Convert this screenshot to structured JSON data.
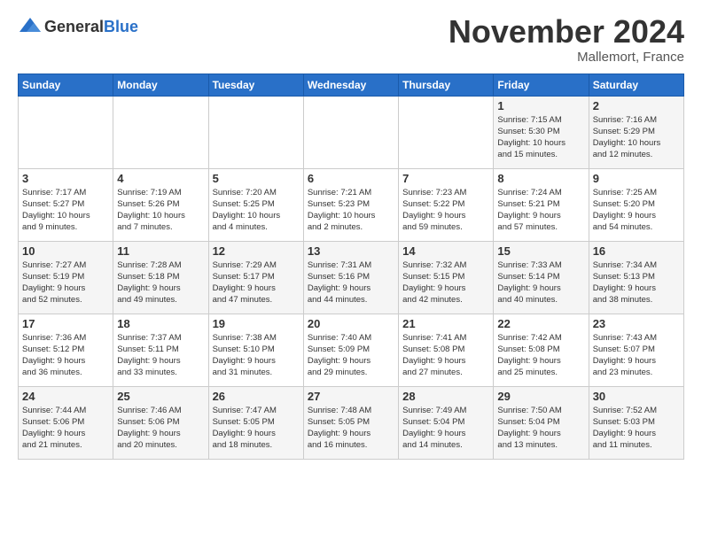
{
  "logo": {
    "text_general": "General",
    "text_blue": "Blue"
  },
  "title": "November 2024",
  "location": "Mallemort, France",
  "days_of_week": [
    "Sunday",
    "Monday",
    "Tuesday",
    "Wednesday",
    "Thursday",
    "Friday",
    "Saturday"
  ],
  "weeks": [
    [
      {
        "num": "",
        "info": ""
      },
      {
        "num": "",
        "info": ""
      },
      {
        "num": "",
        "info": ""
      },
      {
        "num": "",
        "info": ""
      },
      {
        "num": "",
        "info": ""
      },
      {
        "num": "1",
        "info": "Sunrise: 7:15 AM\nSunset: 5:30 PM\nDaylight: 10 hours\nand 15 minutes."
      },
      {
        "num": "2",
        "info": "Sunrise: 7:16 AM\nSunset: 5:29 PM\nDaylight: 10 hours\nand 12 minutes."
      }
    ],
    [
      {
        "num": "3",
        "info": "Sunrise: 7:17 AM\nSunset: 5:27 PM\nDaylight: 10 hours\nand 9 minutes."
      },
      {
        "num": "4",
        "info": "Sunrise: 7:19 AM\nSunset: 5:26 PM\nDaylight: 10 hours\nand 7 minutes."
      },
      {
        "num": "5",
        "info": "Sunrise: 7:20 AM\nSunset: 5:25 PM\nDaylight: 10 hours\nand 4 minutes."
      },
      {
        "num": "6",
        "info": "Sunrise: 7:21 AM\nSunset: 5:23 PM\nDaylight: 10 hours\nand 2 minutes."
      },
      {
        "num": "7",
        "info": "Sunrise: 7:23 AM\nSunset: 5:22 PM\nDaylight: 9 hours\nand 59 minutes."
      },
      {
        "num": "8",
        "info": "Sunrise: 7:24 AM\nSunset: 5:21 PM\nDaylight: 9 hours\nand 57 minutes."
      },
      {
        "num": "9",
        "info": "Sunrise: 7:25 AM\nSunset: 5:20 PM\nDaylight: 9 hours\nand 54 minutes."
      }
    ],
    [
      {
        "num": "10",
        "info": "Sunrise: 7:27 AM\nSunset: 5:19 PM\nDaylight: 9 hours\nand 52 minutes."
      },
      {
        "num": "11",
        "info": "Sunrise: 7:28 AM\nSunset: 5:18 PM\nDaylight: 9 hours\nand 49 minutes."
      },
      {
        "num": "12",
        "info": "Sunrise: 7:29 AM\nSunset: 5:17 PM\nDaylight: 9 hours\nand 47 minutes."
      },
      {
        "num": "13",
        "info": "Sunrise: 7:31 AM\nSunset: 5:16 PM\nDaylight: 9 hours\nand 44 minutes."
      },
      {
        "num": "14",
        "info": "Sunrise: 7:32 AM\nSunset: 5:15 PM\nDaylight: 9 hours\nand 42 minutes."
      },
      {
        "num": "15",
        "info": "Sunrise: 7:33 AM\nSunset: 5:14 PM\nDaylight: 9 hours\nand 40 minutes."
      },
      {
        "num": "16",
        "info": "Sunrise: 7:34 AM\nSunset: 5:13 PM\nDaylight: 9 hours\nand 38 minutes."
      }
    ],
    [
      {
        "num": "17",
        "info": "Sunrise: 7:36 AM\nSunset: 5:12 PM\nDaylight: 9 hours\nand 36 minutes."
      },
      {
        "num": "18",
        "info": "Sunrise: 7:37 AM\nSunset: 5:11 PM\nDaylight: 9 hours\nand 33 minutes."
      },
      {
        "num": "19",
        "info": "Sunrise: 7:38 AM\nSunset: 5:10 PM\nDaylight: 9 hours\nand 31 minutes."
      },
      {
        "num": "20",
        "info": "Sunrise: 7:40 AM\nSunset: 5:09 PM\nDaylight: 9 hours\nand 29 minutes."
      },
      {
        "num": "21",
        "info": "Sunrise: 7:41 AM\nSunset: 5:08 PM\nDaylight: 9 hours\nand 27 minutes."
      },
      {
        "num": "22",
        "info": "Sunrise: 7:42 AM\nSunset: 5:08 PM\nDaylight: 9 hours\nand 25 minutes."
      },
      {
        "num": "23",
        "info": "Sunrise: 7:43 AM\nSunset: 5:07 PM\nDaylight: 9 hours\nand 23 minutes."
      }
    ],
    [
      {
        "num": "24",
        "info": "Sunrise: 7:44 AM\nSunset: 5:06 PM\nDaylight: 9 hours\nand 21 minutes."
      },
      {
        "num": "25",
        "info": "Sunrise: 7:46 AM\nSunset: 5:06 PM\nDaylight: 9 hours\nand 20 minutes."
      },
      {
        "num": "26",
        "info": "Sunrise: 7:47 AM\nSunset: 5:05 PM\nDaylight: 9 hours\nand 18 minutes."
      },
      {
        "num": "27",
        "info": "Sunrise: 7:48 AM\nSunset: 5:05 PM\nDaylight: 9 hours\nand 16 minutes."
      },
      {
        "num": "28",
        "info": "Sunrise: 7:49 AM\nSunset: 5:04 PM\nDaylight: 9 hours\nand 14 minutes."
      },
      {
        "num": "29",
        "info": "Sunrise: 7:50 AM\nSunset: 5:04 PM\nDaylight: 9 hours\nand 13 minutes."
      },
      {
        "num": "30",
        "info": "Sunrise: 7:52 AM\nSunset: 5:03 PM\nDaylight: 9 hours\nand 11 minutes."
      }
    ]
  ]
}
